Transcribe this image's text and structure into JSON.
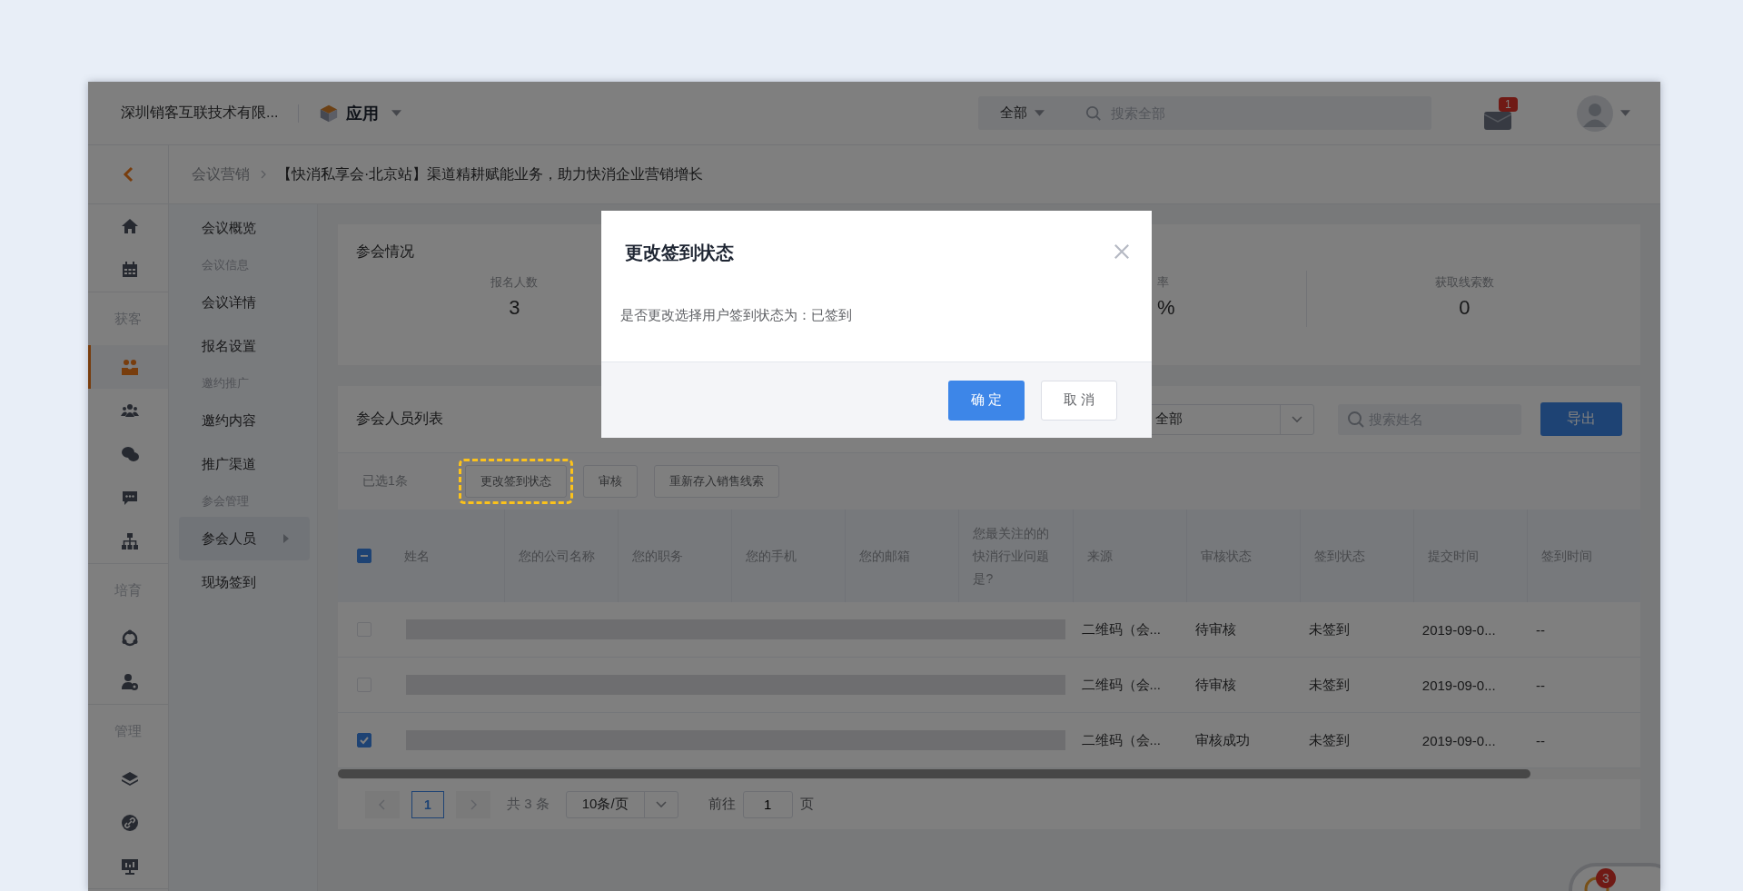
{
  "header": {
    "company": "深圳销客互联技术有限...",
    "app_menu": "应用",
    "search_scope": "全部",
    "search_placeholder": "搜索全部",
    "mail_badge": "1"
  },
  "breadcrumb": [
    "会议营销",
    "【快消私享会·北京站】渠道精耕赋能业务，助力快消企业营销增长"
  ],
  "nav_rail": [
    {
      "items": [
        {
          "selected": false
        },
        {
          "selected": false
        }
      ]
    },
    {
      "label": "获客",
      "items": [
        {
          "selected": true
        },
        {
          "selected": false
        },
        {
          "selected": false
        },
        {
          "selected": false
        },
        {
          "selected": false
        }
      ]
    },
    {
      "label": "培育",
      "items": [
        {
          "selected": false
        },
        {
          "selected": false
        }
      ]
    },
    {
      "label": "管理",
      "items": [
        {
          "selected": false
        },
        {
          "selected": false
        },
        {
          "selected": false
        }
      ]
    }
  ],
  "subnav": [
    {
      "kind": "link",
      "label": "会议概览",
      "selected": false,
      "has_submenu": false
    },
    {
      "kind": "heading",
      "label": "会议信息"
    },
    {
      "kind": "link",
      "label": "会议详情",
      "selected": false,
      "has_submenu": false
    },
    {
      "kind": "link",
      "label": "报名设置",
      "selected": false,
      "has_submenu": false
    },
    {
      "kind": "heading",
      "label": "邀约推广"
    },
    {
      "kind": "link",
      "label": "邀约内容",
      "selected": false,
      "has_submenu": false
    },
    {
      "kind": "link",
      "label": "推广渠道",
      "selected": false,
      "has_submenu": false
    },
    {
      "kind": "heading",
      "label": "参会管理"
    },
    {
      "kind": "link",
      "label": "参会人员",
      "selected": true,
      "has_submenu": true
    },
    {
      "kind": "link",
      "label": "现场签到",
      "selected": false,
      "has_submenu": false
    }
  ],
  "overview": {
    "title": "参会情况",
    "stats": [
      {
        "label": "报名人数",
        "value": "3"
      },
      {
        "label": "率",
        "value": "%"
      },
      {
        "label": "获取线索数",
        "value": "0"
      }
    ]
  },
  "attendees": {
    "title": "参会人员列表",
    "filter": "全部",
    "search_placeholder": "搜索姓名",
    "export": "导出",
    "selected_count": "已选1条",
    "actions": [
      {
        "label": "更改签到状态",
        "highlighted": true
      },
      {
        "label": "审核",
        "highlighted": false
      },
      {
        "label": "重新存入销售线索",
        "highlighted": false
      }
    ],
    "select_all": {
      "indeterminate": true
    },
    "columns": [
      "姓名",
      "您的公司名称",
      "您的职务",
      "您的手机",
      "您的邮箱",
      "您最关注的的快消行业问题是?",
      "来源",
      "审核状态",
      "签到状态",
      "提交时间",
      "签到时间"
    ],
    "rows": [
      {
        "checked": false,
        "redacted": true,
        "source": "二维码（会...",
        "review": "待审核",
        "checkin": "未签到",
        "submitted": "2019-09-0...",
        "checkin_time": "--"
      },
      {
        "checked": false,
        "redacted": true,
        "source": "二维码（会...",
        "review": "待审核",
        "checkin": "未签到",
        "submitted": "2019-09-0...",
        "checkin_time": "--"
      },
      {
        "checked": true,
        "redacted": true,
        "source": "二维码（会...",
        "review": "审核成功",
        "checkin": "未签到",
        "submitted": "2019-09-0...",
        "checkin_time": "--"
      }
    ],
    "pagination": {
      "pages": [
        {
          "label": "1",
          "selected": true
        }
      ],
      "total": "共 3 条",
      "page_size": "10条/页",
      "goto_label": "前往",
      "goto_value": "1",
      "page_suffix": "页"
    }
  },
  "chat_widget": {
    "badge": "3"
  },
  "dialog": {
    "title": "更改签到状态",
    "message": "是否更改选择用户签到状态为：已签到",
    "confirm": "确 定",
    "cancel": "取 消"
  }
}
